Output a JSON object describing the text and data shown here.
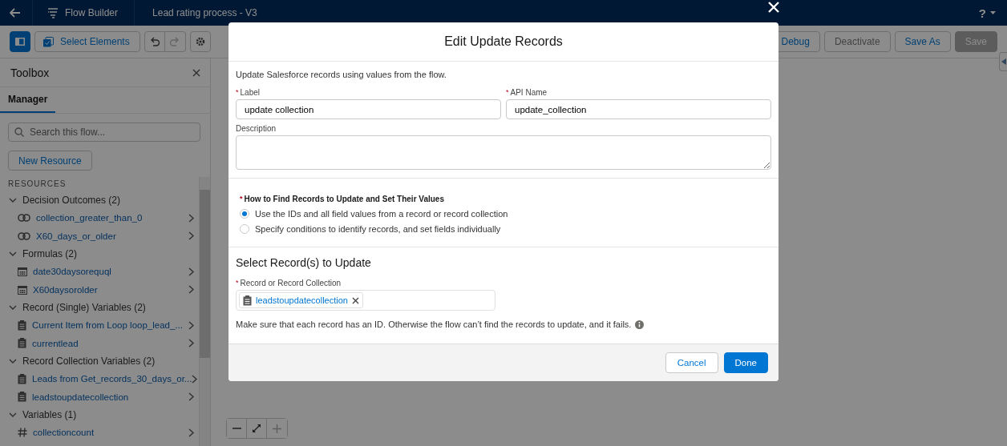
{
  "header": {
    "app_name": "Flow Builder",
    "flow_title": "Lead rating process - V3",
    "help": "?"
  },
  "toolbar": {
    "select_button": "Select Elements",
    "right_buttons": [
      {
        "label": "Debug",
        "disabled": false,
        "kind": "neutral"
      },
      {
        "label": "Deactivate",
        "disabled": true,
        "kind": "neutral"
      },
      {
        "label": "Save As",
        "disabled": false,
        "kind": "neutral"
      },
      {
        "label": "Save",
        "disabled": true,
        "kind": "brand"
      }
    ]
  },
  "toolbox": {
    "title": "Toolbox",
    "tabs": [
      {
        "label": "Manager",
        "selected": true
      }
    ],
    "search": {
      "placeholder": "Search this flow..."
    },
    "new_resource": "New Resource",
    "section": "RESOURCES",
    "groups": [
      {
        "label": "Decision Outcomes (2)",
        "expanded": true,
        "children": [
          {
            "label": "collection_greater_than_0",
            "kind": "outcome"
          },
          {
            "label": "X60_days_or_older",
            "kind": "outcome"
          }
        ]
      },
      {
        "label": "Formulas (2)",
        "expanded": true,
        "children": [
          {
            "label": "date30daysorequql",
            "kind": "formula"
          },
          {
            "label": "X60daysorolder",
            "kind": "formula"
          }
        ]
      },
      {
        "label": "Record (Single) Variables (2)",
        "expanded": true,
        "children": [
          {
            "label": "Current Item from Loop loop_lead_...",
            "kind": "record"
          },
          {
            "label": "currentlead",
            "kind": "record"
          }
        ]
      },
      {
        "label": "Record Collection Variables (2)",
        "expanded": true,
        "children": [
          {
            "label": "Leads from Get_records_30_days_or...",
            "kind": "record"
          },
          {
            "label": "leadstoupdatecollection",
            "kind": "record"
          }
        ]
      },
      {
        "label": "Variables (1)",
        "expanded": true,
        "children": [
          {
            "label": "collectioncount",
            "kind": "number"
          }
        ]
      }
    ]
  },
  "modal": {
    "title": "Edit Update Records",
    "description": "Update Salesforce records using values from the flow.",
    "label_field": {
      "label": "Label",
      "required_mark": "*",
      "value": "update collection"
    },
    "api_name_field": {
      "label": "API Name",
      "required_mark": "*",
      "value": "update_collection"
    },
    "description_field": {
      "label": "Description"
    },
    "find_method": {
      "label": "How to Find Records to Update and Set Their Values",
      "required_mark": "*",
      "options": [
        {
          "label": "Use the IDs and all field values from a record or record collection",
          "selected": true
        },
        {
          "label": "Specify conditions to identify records, and set fields individually",
          "selected": false
        }
      ]
    },
    "section_title": "Select Record(s) to Update",
    "record_field": {
      "label": "Record or Record Collection",
      "required_mark": "*",
      "pill": "leadstoupdatecollection"
    },
    "help_text": "Make sure that each record has an ID. Otherwise the flow can’t find the records to update, and it fails.",
    "footer_buttons": [
      {
        "label": "Cancel",
        "kind": "neutral"
      },
      {
        "label": "Done",
        "kind": "brand"
      }
    ]
  }
}
